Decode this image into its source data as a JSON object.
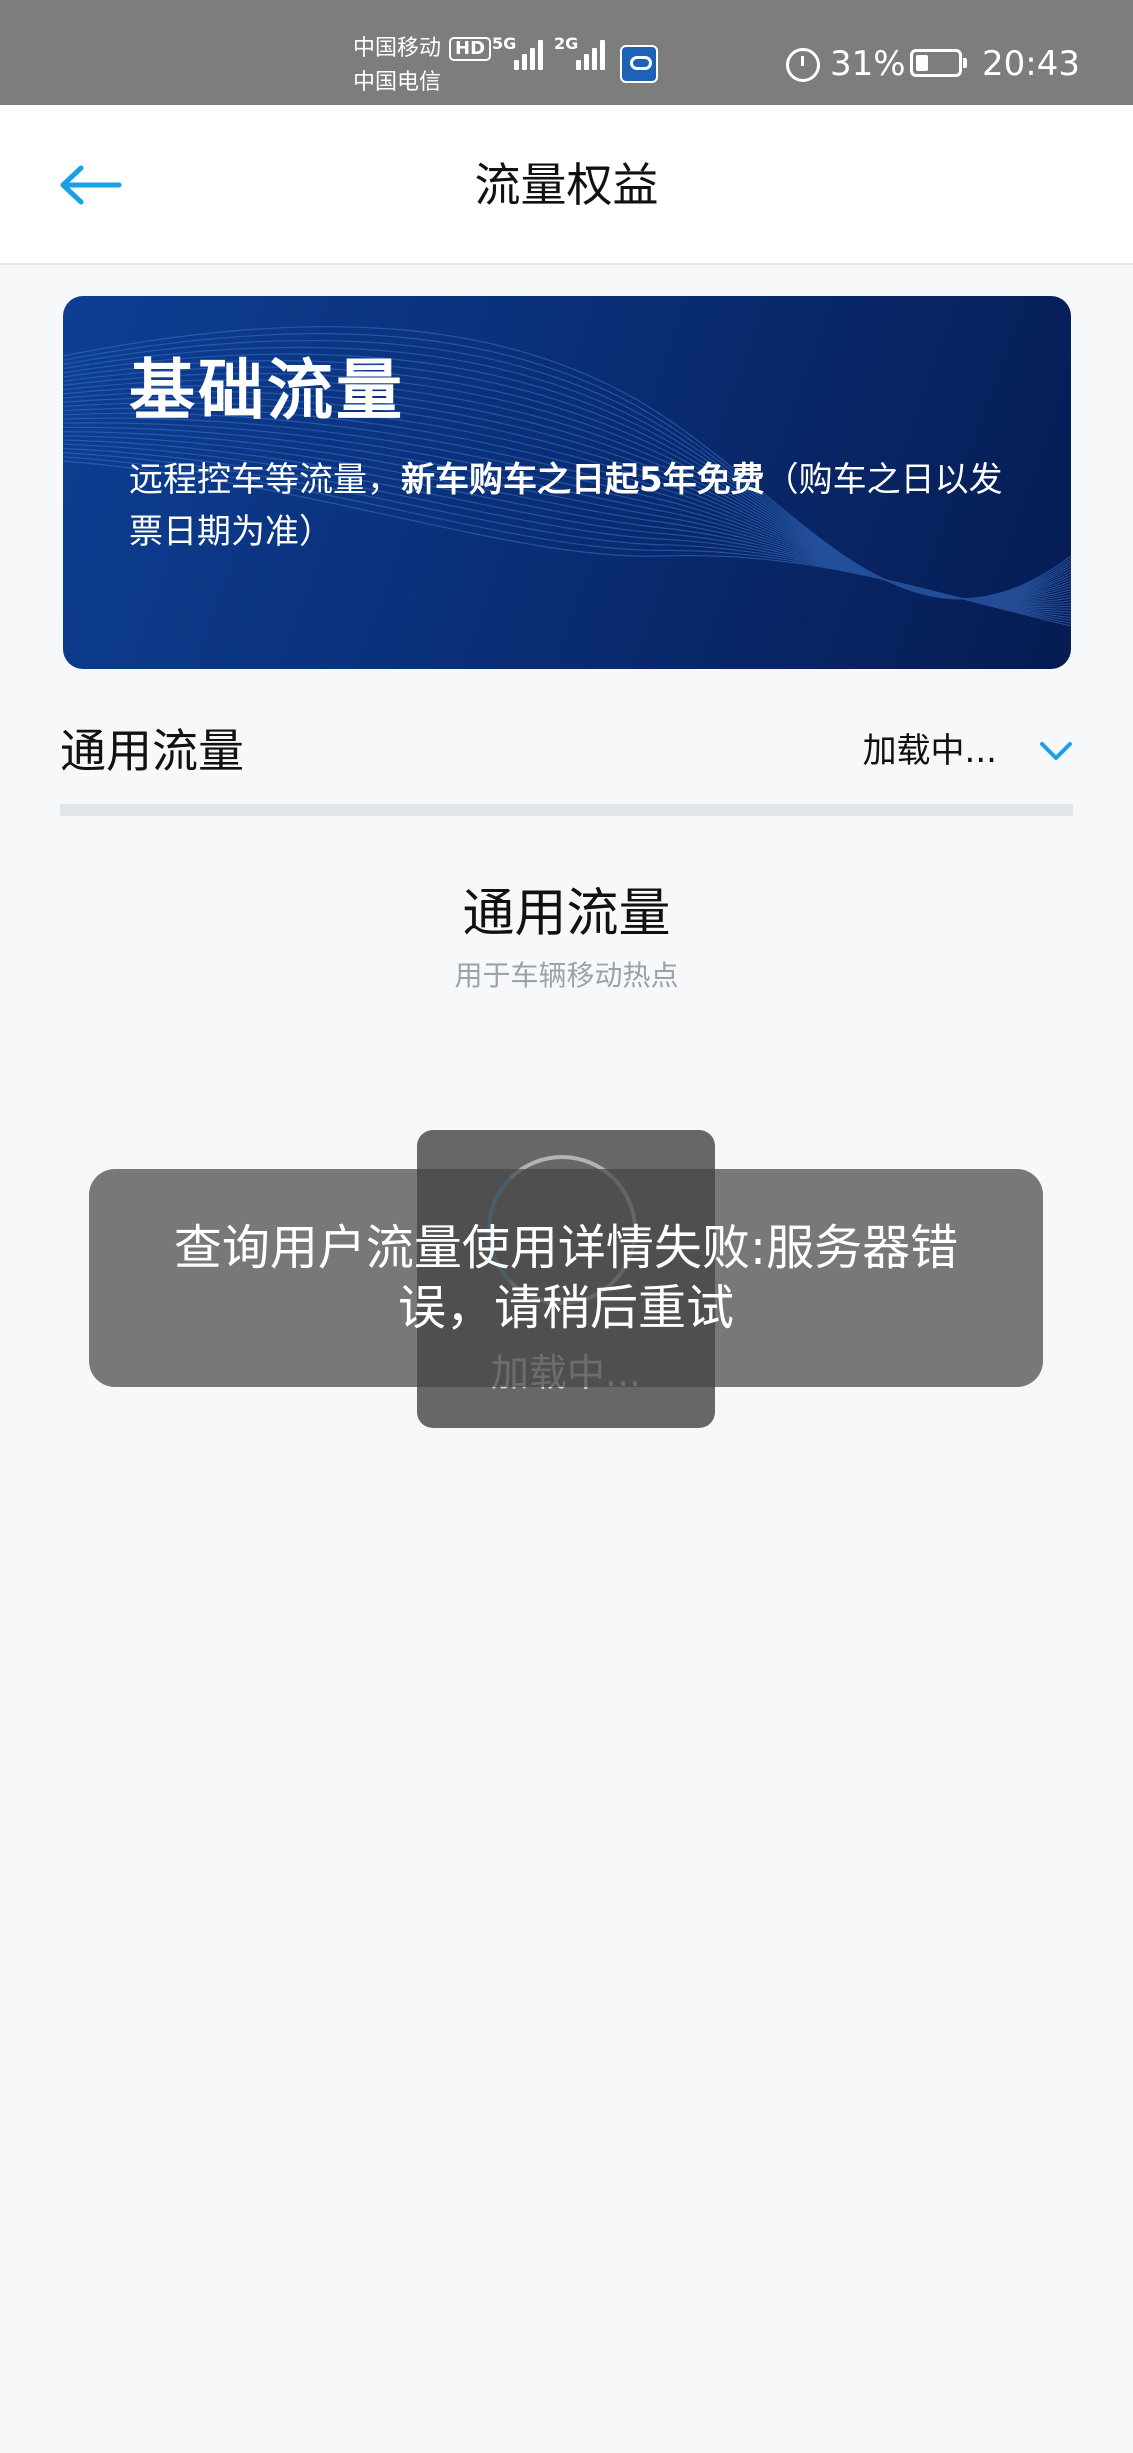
{
  "status_bar": {
    "carrier_1": "中国移动",
    "hd_badge": "HD",
    "carrier_2": "中国电信",
    "sig1_label": "5G",
    "sig2_label": "2G",
    "battery_percent": "31%",
    "battery_level": 0.31,
    "time": "20:43"
  },
  "nav": {
    "title": "流量权益",
    "back_icon": "arrow-left-icon"
  },
  "banner": {
    "title": "基础流量",
    "desc_plain_1": "远程控车等流量，",
    "desc_bold": "新车购车之日起5年免费",
    "desc_plain_2": "（购车之日以发票日期为准）"
  },
  "section": {
    "title": "通用流量",
    "dropdown_value": "加载中...",
    "dropdown_icon": "chevron-down-icon"
  },
  "sub": {
    "title": "通用流量",
    "caption": "用于车辆移动热点"
  },
  "loading": {
    "text": "加载中..."
  },
  "toast": {
    "message": "查询用户流量使用详情失败:服务器错误，请稍后重试"
  },
  "colors": {
    "accent": "#1aa0e6",
    "banner_dark": "#061c52",
    "status_bar": "#7d7d7d"
  }
}
